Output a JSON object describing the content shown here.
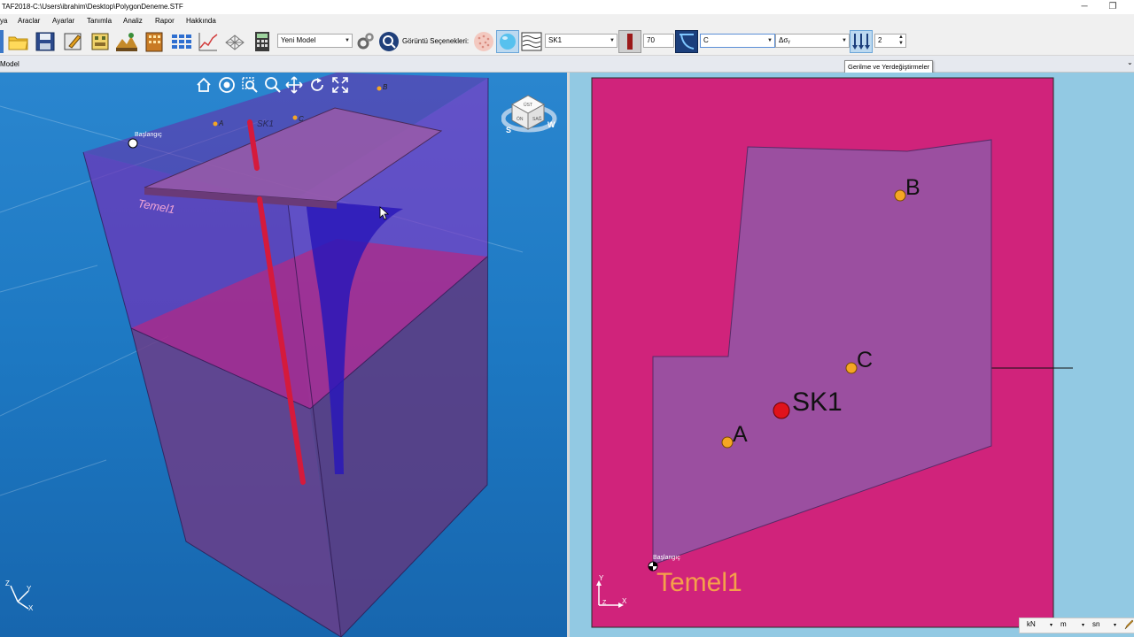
{
  "window": {
    "title": "TAF2018-C:\\Users\\ibrahim\\Desktop\\PolygonDeneme.STF",
    "minimize_glyph": "─",
    "restore_glyph": "❐"
  },
  "menu": [
    "ya",
    "Araclar",
    "Ayarlar",
    "Tanımla",
    "Analiz",
    "Rapor",
    "Hakkında"
  ],
  "toolbar": {
    "model_combo": "Yeni Model",
    "view_options_label": "Görüntü Seçenekleri:",
    "borehole_combo": "SK1",
    "depth_value": "70",
    "point_combo": "C",
    "stress_combo": "Δσᵧ",
    "count_value": "2",
    "icons": [
      "folder-open-icon",
      "save-icon",
      "edit-icon",
      "building-icon",
      "terrain-icon",
      "building-grid-icon",
      "grid-table-icon",
      "chart-icon",
      "mesh-icon",
      "calculator-icon",
      "settings-icon",
      "search-icon",
      "texture-icon",
      "sphere-icon",
      "layers-icon",
      "borehole-icon",
      "stress-curve-icon",
      "load-arrows-icon"
    ]
  },
  "subbar": {
    "tab_label": "Model",
    "tooltip": "Gerilme ve Yerdeğiştirmeler"
  },
  "view3d": {
    "foundation_label": "Temel1",
    "origin_label": "Başlangıç",
    "borehole_label": "SK1",
    "point_labels": [
      "A",
      "C",
      "B"
    ],
    "axis_labels": {
      "x": "X",
      "y": "Y",
      "z": "Z"
    },
    "cube_faces": [
      "ÜST",
      "ÖN",
      "SAĞ"
    ],
    "compass_s": "S",
    "compass_w": "W",
    "nav_tools": [
      "home-icon",
      "orbit-icon",
      "zoom-window-icon",
      "zoom-icon",
      "pan-icon",
      "rotate-icon",
      "fit-icon"
    ]
  },
  "view2d": {
    "foundation_label": "Temel1",
    "origin_label": "Başlangıç",
    "borehole_label": "SK1",
    "points": [
      {
        "label": "A"
      },
      {
        "label": "C"
      },
      {
        "label": "B"
      }
    ],
    "axis_labels": {
      "x": "X",
      "y": "Y",
      "z": "Z"
    },
    "colors": {
      "background": "#92c9e3",
      "soil": "#d0237b",
      "foundation": "#9b4fa0",
      "point": "#f5a623",
      "borehole": "#e0121b"
    }
  },
  "statusbar": {
    "force_unit": "kN",
    "length_unit": "m",
    "time_unit": "sn"
  }
}
